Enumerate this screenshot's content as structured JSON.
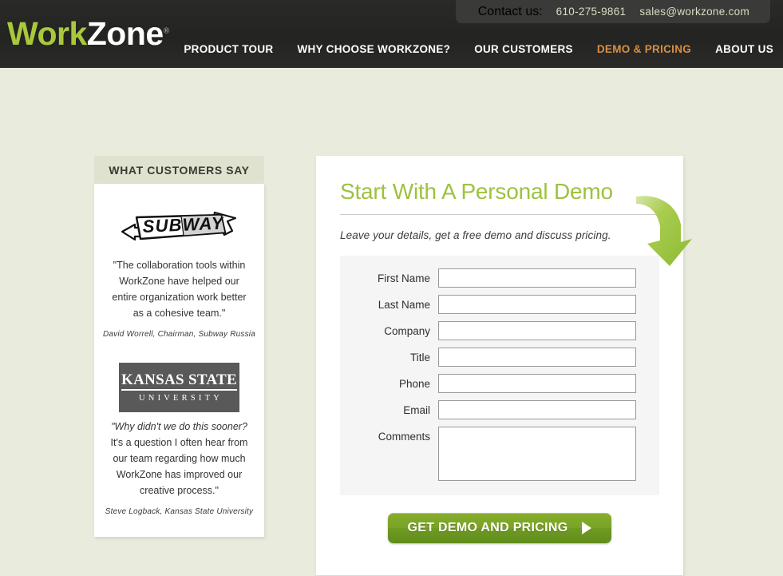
{
  "header": {
    "contact": {
      "label": "Contact us:",
      "phone": "610-275-9861",
      "email": "sales@workzone.com"
    },
    "logo": {
      "part1": "Work",
      "part2": "Zone",
      "registered": "®"
    },
    "nav": [
      {
        "label": "PRODUCT TOUR",
        "active": false
      },
      {
        "label": "WHY CHOOSE WORKZONE?",
        "active": false
      },
      {
        "label": "OUR CUSTOMERS",
        "active": false
      },
      {
        "label": "DEMO & PRICING",
        "active": true
      },
      {
        "label": "ABOUT US",
        "active": false
      }
    ],
    "colors": {
      "bar_background": "#272725",
      "logo_green": "#a9c93c",
      "active_nav": "#d99042"
    }
  },
  "sidebar": {
    "heading": "WHAT CUSTOMERS SAY",
    "testimonials": [
      {
        "logo_name": "subway-logo",
        "logo_text": "SUBWAY",
        "quote": "\"The collaboration tools within WorkZone have helped our entire organization work better\nas a cohesive team.\"",
        "attribution": "David Worrell, Chairman, Subway Russia"
      },
      {
        "logo_name": "kansas-state-university-logo",
        "logo_line1": "KANSAS STATE",
        "logo_line2": "UNIVERSITY",
        "quote_italic": "\"Why didn't we do this sooner?",
        "quote_rest": " It's a question I often hear from our team regarding how much WorkZone has improved our creative process.\"",
        "attribution": "Steve Logback, Kansas State University"
      }
    ]
  },
  "main": {
    "title": "Start With A Personal Demo",
    "subtitle": "Leave your details, get a free demo and discuss pricing.",
    "title_color": "#9dc23e",
    "form": {
      "fields": [
        {
          "label": "First Name",
          "value": "",
          "placeholder": "",
          "type": "text",
          "name": "first-name"
        },
        {
          "label": "Last Name",
          "value": "",
          "placeholder": "",
          "type": "text",
          "name": "last-name"
        },
        {
          "label": "Company",
          "value": "",
          "placeholder": "",
          "type": "text",
          "name": "company"
        },
        {
          "label": "Title",
          "value": "",
          "placeholder": "",
          "type": "text",
          "name": "title"
        },
        {
          "label": "Phone",
          "value": "",
          "placeholder": "",
          "type": "text",
          "name": "phone"
        },
        {
          "label": "Email",
          "value": "",
          "placeholder": "",
          "type": "text",
          "name": "email"
        },
        {
          "label": "Comments",
          "value": "",
          "placeholder": "",
          "type": "textarea",
          "name": "comments"
        }
      ],
      "submit_label": "GET DEMO AND PRICING",
      "submit_color": "#7ba427"
    }
  },
  "page": {
    "background_color": "#e9ebdc"
  }
}
